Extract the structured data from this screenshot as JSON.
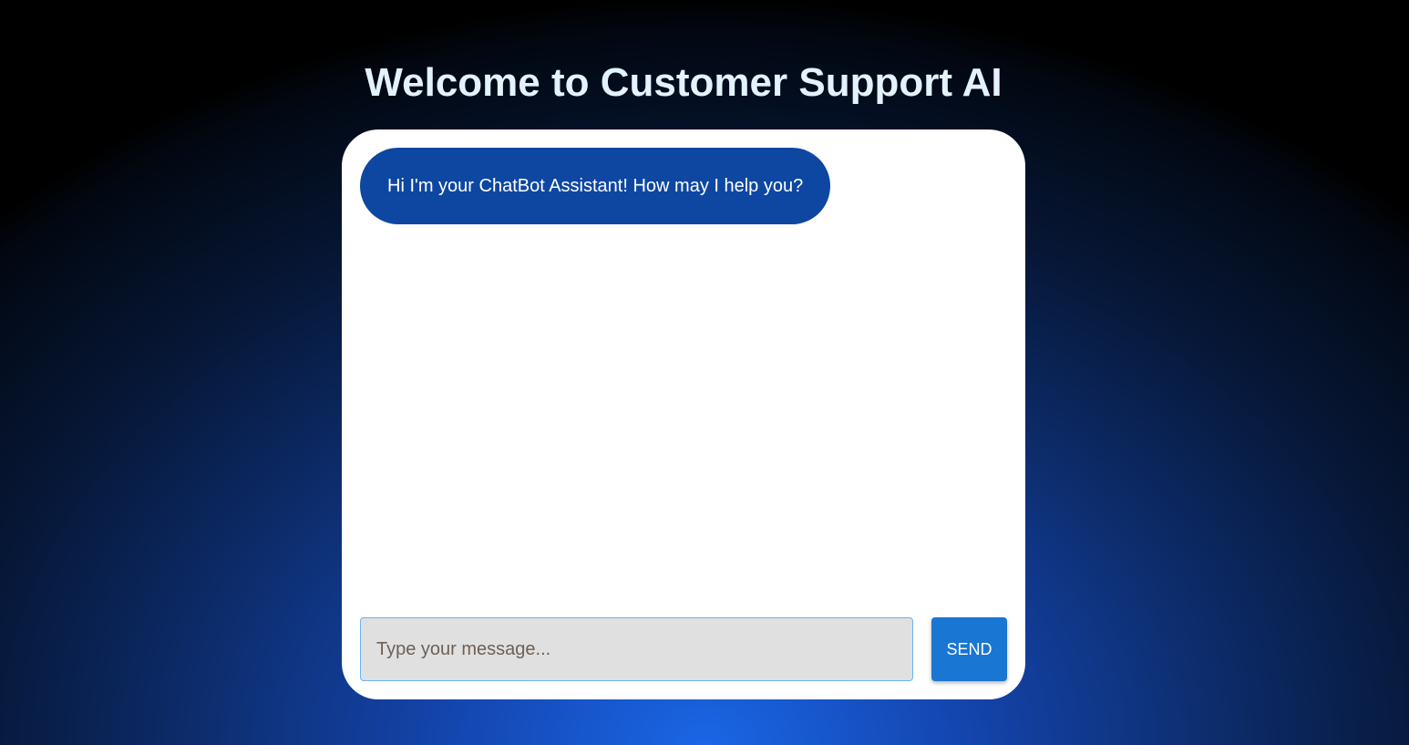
{
  "header": {
    "title": "Welcome to Customer Support AI"
  },
  "chat": {
    "messages": [
      {
        "sender": "bot",
        "text": "Hi I'm your ChatBot Assistant! How may I help you?"
      }
    ],
    "input": {
      "value": "",
      "placeholder": "Type your message..."
    },
    "send_label": "SEND"
  },
  "colors": {
    "bot_bubble": "#0d47a1",
    "send_button": "#1976d2",
    "title": "#e3f2fd",
    "input_bg": "#e0e0e0",
    "input_border": "#64b5f6"
  }
}
